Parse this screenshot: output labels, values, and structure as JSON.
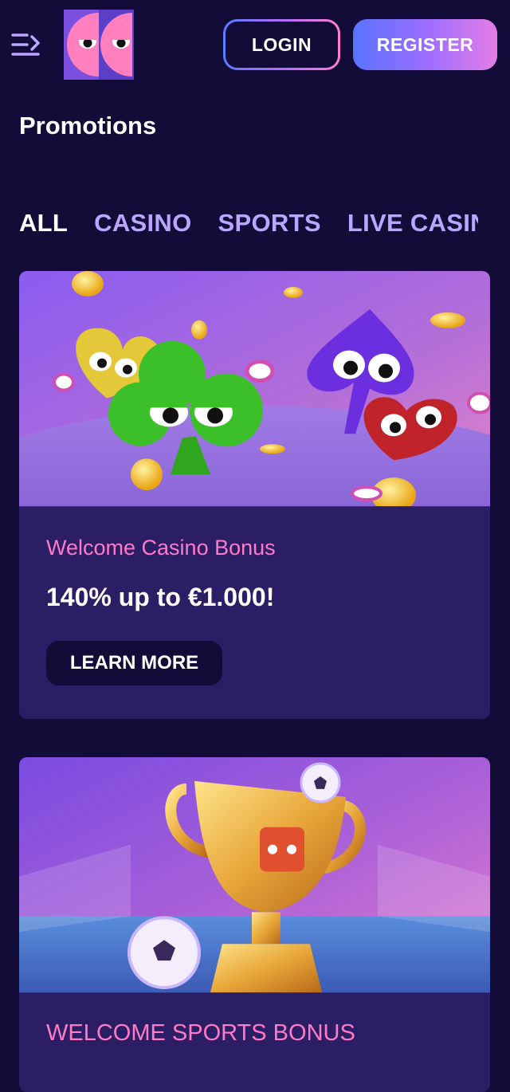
{
  "header": {
    "menu_icon": "menu-icon",
    "logo_icon": "googly-eyes-logo",
    "login_label": "LOGIN",
    "register_label": "REGISTER"
  },
  "page": {
    "title": "Promotions"
  },
  "tabs": [
    {
      "label": "ALL",
      "active": true
    },
    {
      "label": "CASINO",
      "active": false
    },
    {
      "label": "SPORTS",
      "active": false
    },
    {
      "label": "LIVE CASINO",
      "active": false
    }
  ],
  "promotions": [
    {
      "label": "Welcome Casino Bonus",
      "headline": "140% up to €1.000!",
      "button_label": "LEARN MORE"
    },
    {
      "label": "WELCOME SPORTS BONUS"
    }
  ],
  "colors": {
    "background": "#130b38",
    "card": "#2b1e64",
    "accent_pink": "#ff7bc8",
    "tab_inactive": "#b9a6ff"
  }
}
